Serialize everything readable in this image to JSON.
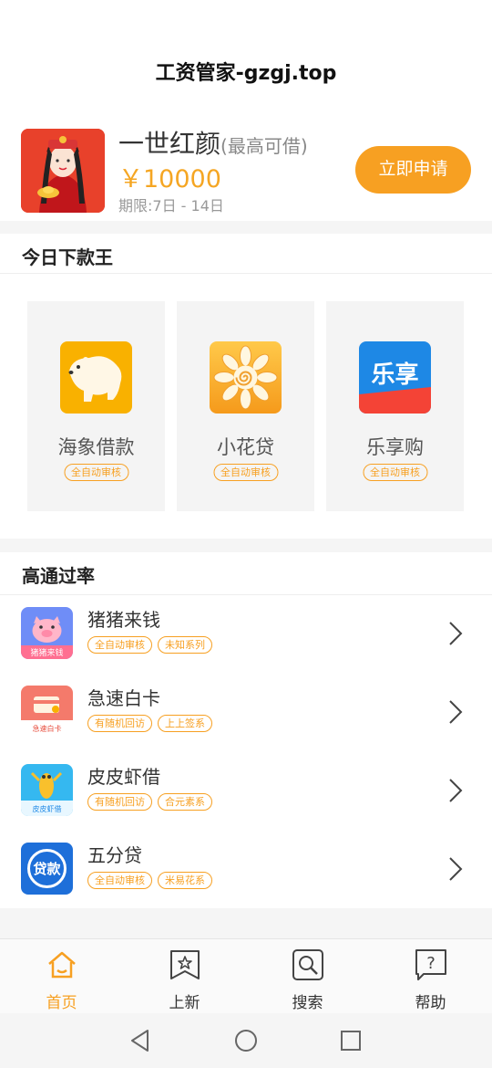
{
  "header": {
    "title": "工资管家-gzgj.top"
  },
  "featured": {
    "name": "一世红颜",
    "name_sub": "(最高可借)",
    "amount": "￥10000",
    "term": "期限:7日 - 14日",
    "apply_label": "立即申请"
  },
  "king": {
    "title": "今日下款王",
    "cards": [
      {
        "name": "海象借款",
        "tag": "全自动审核",
        "icon": "polar-bear-icon"
      },
      {
        "name": "小花贷",
        "tag": "全自动审核",
        "icon": "flower-icon"
      },
      {
        "name": "乐享购",
        "tag": "全自动审核",
        "icon": "lexiang-icon",
        "icon_text": "乐享"
      }
    ]
  },
  "pass": {
    "title": "高通过率",
    "items": [
      {
        "name": "猪猪来钱",
        "tags": [
          "全自动审核",
          "未知系列"
        ],
        "icon": "pig-icon",
        "icon_text": "猪猪来钱"
      },
      {
        "name": "急速白卡",
        "tags": [
          "有随机回访",
          "上上签系"
        ],
        "icon": "card-icon",
        "icon_text": "急速白卡"
      },
      {
        "name": "皮皮虾借",
        "tags": [
          "有随机回访",
          "合元素系"
        ],
        "icon": "shrimp-icon",
        "icon_text": "皮皮虾借"
      },
      {
        "name": "五分贷",
        "tags": [
          "全自动审核",
          "米易花系"
        ],
        "icon": "loan-icon",
        "icon_text": "贷款"
      }
    ]
  },
  "tabbar": {
    "tabs": [
      {
        "label": "首页",
        "icon": "home-icon",
        "active": true
      },
      {
        "label": "上新",
        "icon": "bookmark-star-icon"
      },
      {
        "label": "搜索",
        "icon": "search-icon"
      },
      {
        "label": "帮助",
        "icon": "help-icon",
        "icon_text": "?"
      }
    ]
  },
  "colors": {
    "accent": "#f7a022",
    "amount": "#f5a623"
  }
}
